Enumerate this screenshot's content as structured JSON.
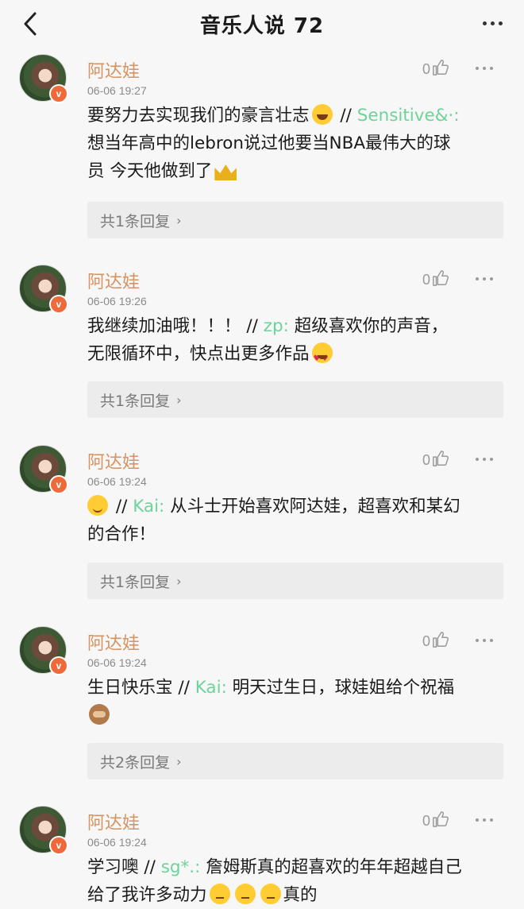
{
  "header": {
    "title": "音乐人说 72"
  },
  "comments": [
    {
      "name": "阿达娃",
      "time": "06-06 19:27",
      "likes": "0",
      "reply_text": "要努力去实现我们的豪言壮志",
      "mention": "Sensitive&·:",
      "quoted_line1": "想当年高中的lebron说过他要当NBA最伟大的球",
      "quoted_line2": "员 今天他做到了",
      "replies_label": "共1条回复"
    },
    {
      "name": "阿达娃",
      "time": "06-06 19:26",
      "likes": "0",
      "reply_text": "我继续加油哦！！！",
      "mention": "zp:",
      "quoted_line1": "超级喜欢你的声音，",
      "quoted_line2": "无限循环中，快点出更多作品",
      "replies_label": "共1条回复"
    },
    {
      "name": "阿达娃",
      "time": "06-06 19:24",
      "likes": "0",
      "reply_text": "",
      "mention": "Kai:",
      "quoted_line1": "从斗士开始喜欢阿达娃，超喜欢和某幻",
      "quoted_line2": "的合作！",
      "replies_label": "共1条回复"
    },
    {
      "name": "阿达娃",
      "time": "06-06 19:24",
      "likes": "0",
      "reply_text": "生日快乐宝",
      "mention": "Kai:",
      "quoted_line1": "明天过生日，球娃姐给个祝福",
      "quoted_line2": "",
      "replies_label": "共2条回复"
    },
    {
      "name": "阿达娃",
      "time": "06-06 19:24",
      "likes": "0",
      "reply_text": "学习噢",
      "mention": "sg*.:",
      "quoted_line1": "詹姆斯真的超喜欢的年年超越自己",
      "quoted_line2": "给了我许多动力",
      "quoted_tail": "真的",
      "replies_label": ""
    }
  ],
  "separator": "//",
  "badge_letter": "v"
}
